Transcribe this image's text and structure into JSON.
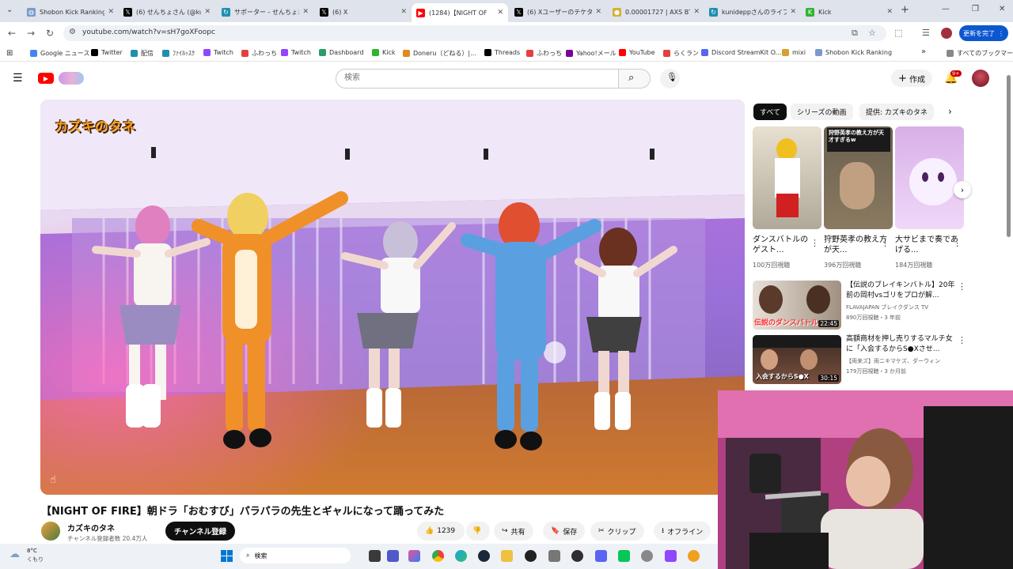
{
  "browser": {
    "tabs": [
      {
        "label": "Shobon Kick Ranking",
        "icon": "globe-icon",
        "color": "#7a9acd"
      },
      {
        "label": "(6) せんちょさん (@kur",
        "icon": "x-icon",
        "color": "#000000"
      },
      {
        "label": "サポーター - せんちょさん",
        "icon": "refresh-icon",
        "color": "#1f8fb0"
      },
      {
        "label": "(6) X",
        "icon": "x-icon",
        "color": "#000000"
      },
      {
        "label": "(1284)【NIGHT OF",
        "icon": "youtube-icon",
        "color": "#ff0000",
        "active": true
      },
      {
        "label": "(6) Xユーザーのテケタ",
        "icon": "x-icon",
        "color": "#000000"
      },
      {
        "label": "0.00001727 | AXS BTC",
        "icon": "coin-icon",
        "color": "#d8b030"
      },
      {
        "label": "kunideppさんのライブ",
        "icon": "refresh-icon",
        "color": "#1f8fb0"
      },
      {
        "label": "Kick",
        "icon": "kick-icon",
        "color": "#2fb52f"
      }
    ],
    "new_tab": "+",
    "url": "youtube.com/watch?v=sH7goXFoopc",
    "update_button": "更新を完了",
    "bookmarks": [
      {
        "label": "Google ニュース",
        "color": "#4285f4"
      },
      {
        "label": "Twitter",
        "color": "#000000"
      },
      {
        "label": "配信",
        "color": "#1f8fb0"
      },
      {
        "label": "ﾌｧｲﾙｯｽｸ",
        "color": "#1f8fb0"
      },
      {
        "label": "Twitch",
        "color": "#9146ff"
      },
      {
        "label": "ふわっち",
        "color": "#e44040"
      },
      {
        "label": "Twitch",
        "color": "#9146ff"
      },
      {
        "label": "Dashboard",
        "color": "#2a9d6a"
      },
      {
        "label": "Kick",
        "color": "#2fb52f"
      },
      {
        "label": "Doneru（どねる）|...",
        "color": "#e08a20"
      },
      {
        "label": "Threads",
        "color": "#000000"
      },
      {
        "label": "ふわっち",
        "color": "#e44040"
      },
      {
        "label": "Yahoo!メール",
        "color": "#7b0099"
      },
      {
        "label": "YouTube",
        "color": "#ff0000"
      },
      {
        "label": "らくラン",
        "color": "#e44040"
      },
      {
        "label": "Discord StreamKit O...",
        "color": "#5865f2"
      },
      {
        "label": "mixi",
        "color": "#d8a030"
      },
      {
        "label": "Shobon Kick Ranking",
        "color": "#7a9acd"
      }
    ],
    "bookmarks_overflow": "»",
    "all_bookmarks": "すべてのブックマーク"
  },
  "youtube": {
    "search_placeholder": "検索",
    "create_label": "作成",
    "notifications_badge": "9+",
    "video": {
      "overlay_logo": "カズキのタネ",
      "title": "【NIGHT OF FIRE】朝ドラ「おむすび」パラパラの先生とギャルになって踊ってみた",
      "channel_name": "カズキのタネ",
      "subscribers": "チャンネル登録者数 20.4万人",
      "subscribe_label": "チャンネル登録",
      "likes": "1239",
      "share_label": "共有",
      "save_label": "保存",
      "clip_label": "クリップ",
      "offline_label": "オフライン"
    },
    "chips": [
      "すべて",
      "シリーズの動画",
      "提供: カズキのタネ"
    ],
    "shorts": [
      {
        "title": "ダンスバトルのゲスト...",
        "views": "100万回視聴"
      },
      {
        "title": "狩野英孝の教え方が天...",
        "views": "396万回視聴",
        "thumb_text": "狩野英孝の教え方が天才すぎるw"
      },
      {
        "title": "大サビまで奏であげる...",
        "views": "184万回視聴"
      }
    ],
    "related": [
      {
        "title": "【伝説のブレイキンバトル】20年前の岡村vsゴリをプロが解...",
        "channel": "FLAVAJAPAN ブレイクダンス TV",
        "meta": "890万回視聴・3 年前",
        "duration": "22:45",
        "thumb_text": "伝説のダンスバトル"
      },
      {
        "title": "高額商材を押し売りするマルチ女に「入会するからS●Xさせ...",
        "channel": "【両来ズ】両ニキマケズ、ダーウィン",
        "meta": "179万回視聴・3 か月前",
        "duration": "30:15",
        "thumb_text": "入会するからS●X"
      }
    ]
  },
  "taskbar": {
    "weather_temp": "8°C",
    "weather_desc": "くもり",
    "search_label": "検索"
  }
}
